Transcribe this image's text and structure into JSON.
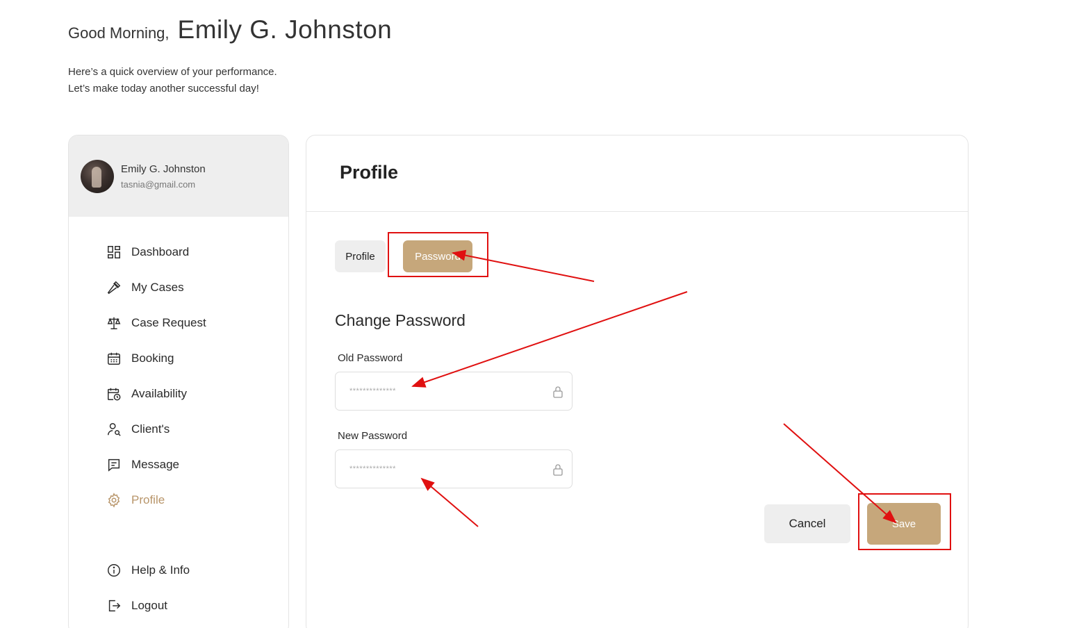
{
  "greeting": {
    "prefix": "Good Morning,",
    "name": "Emily G. Johnston",
    "line1": "Here’s a quick overview of your performance.",
    "line2": "Let’s make today another successful day!"
  },
  "user": {
    "name": "Emily G. Johnston",
    "email": "tasnia@gmail.com"
  },
  "nav": {
    "items": [
      {
        "label": "Dashboard",
        "icon": "dashboard-icon"
      },
      {
        "label": "My Cases",
        "icon": "gavel-icon"
      },
      {
        "label": "Case Request",
        "icon": "scales-icon"
      },
      {
        "label": "Booking",
        "icon": "calendar-icon"
      },
      {
        "label": "Availability",
        "icon": "calendar-clock-icon"
      },
      {
        "label": "Client's",
        "icon": "user-search-icon"
      },
      {
        "label": "Message",
        "icon": "message-icon"
      },
      {
        "label": "Profile",
        "icon": "gear-icon",
        "active": true
      },
      {
        "label": "Help & Info",
        "icon": "info-icon"
      },
      {
        "label": "Logout",
        "icon": "logout-icon"
      }
    ]
  },
  "main": {
    "title": "Profile",
    "tabs": [
      {
        "label": "Profile"
      },
      {
        "label": "Password",
        "active": true
      }
    ],
    "section_title": "Change Password",
    "old_password": {
      "label": "Old Password",
      "placeholder": "**************"
    },
    "new_password": {
      "label": "New Password",
      "placeholder": "**************"
    },
    "cancel_label": "Cancel",
    "save_label": "Save"
  },
  "colors": {
    "accent": "#c6a77b",
    "active_nav": "#b8956a",
    "annotation": "#e01010"
  }
}
